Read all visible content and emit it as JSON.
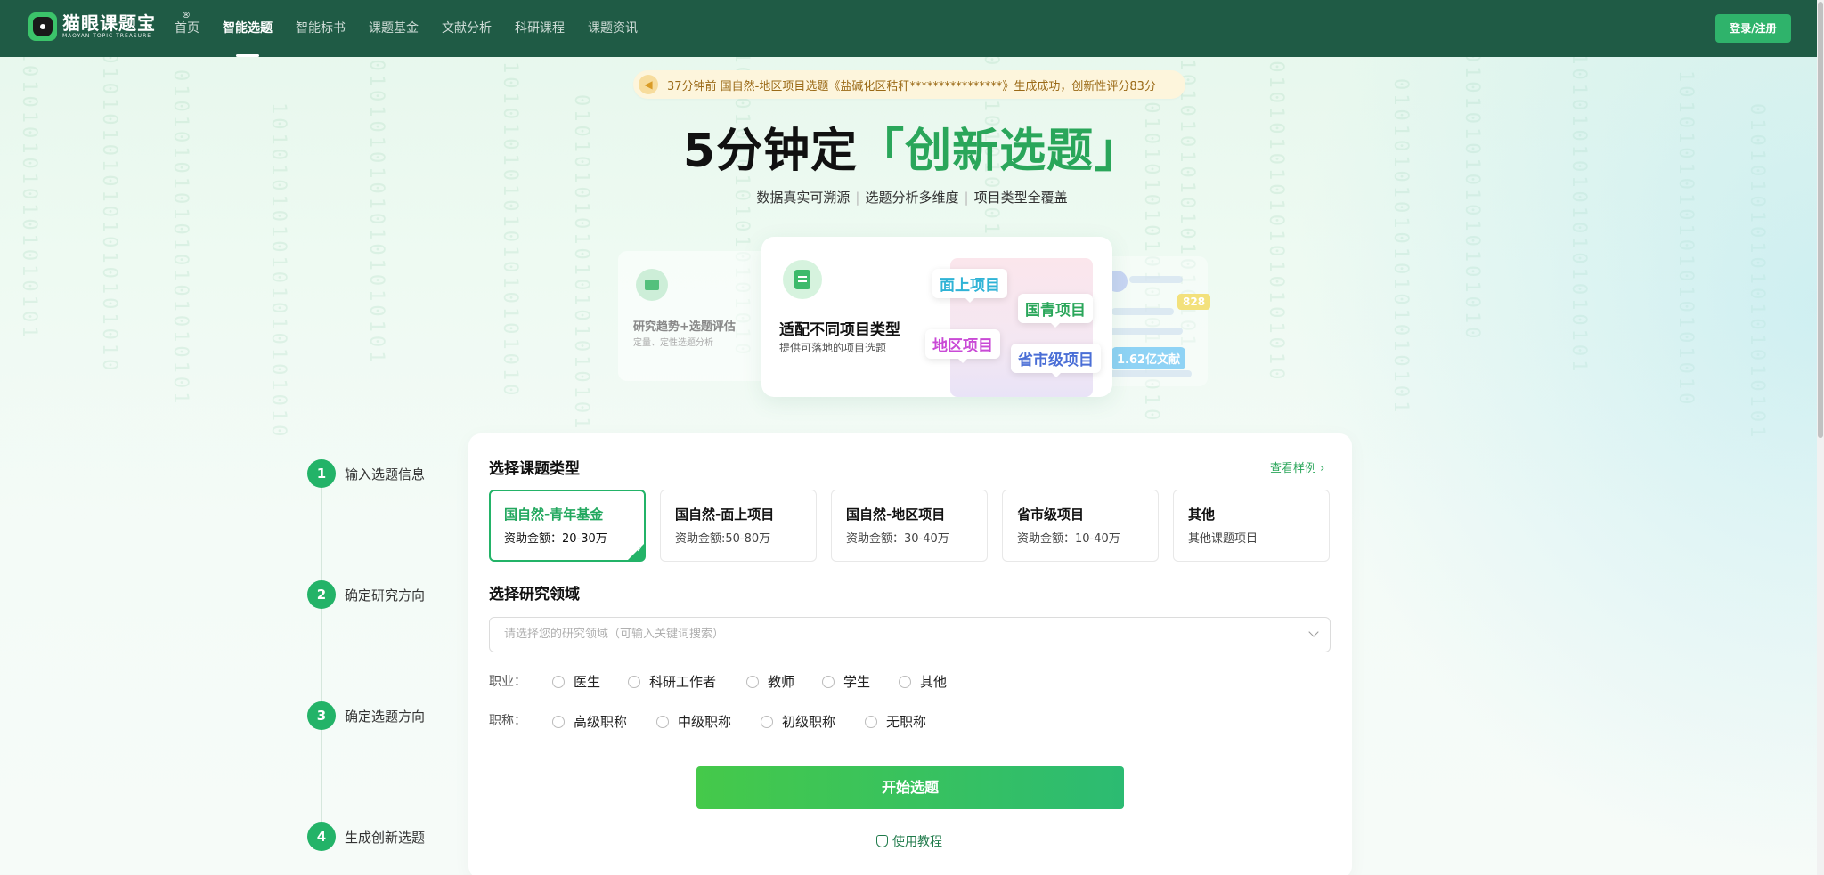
{
  "header": {
    "logo_cn": "猫眼课题宝",
    "logo_en": "MAOYAN TOPIC TREASURE",
    "logo_reg": "®",
    "nav": [
      {
        "label": "首页"
      },
      {
        "label": "智能选题",
        "active": true
      },
      {
        "label": "智能标书"
      },
      {
        "label": "课题基金"
      },
      {
        "label": "文献分析"
      },
      {
        "label": "科研课程"
      },
      {
        "label": "课题资讯"
      }
    ],
    "login_label": "登录/注册"
  },
  "notice": {
    "text": "37分钟前  国自然-地区项目选题《盐碱化区秸秆****************》生成成功，创新性评分83分",
    "icon": "speaker-icon"
  },
  "hero": {
    "title_prefix": "5分钟定",
    "title_accent": "「创新选题」",
    "sub": [
      "数据真实可溯源",
      "选题分析多维度",
      "项目类型全覆盖"
    ]
  },
  "carousel": {
    "left": {
      "title": "研究趋势+选题评估",
      "sub": "定量、定性选题分析"
    },
    "main": {
      "title": "适配不同项目类型",
      "sub": "提供可落地的项目选题",
      "tags": [
        {
          "label": "面上项目",
          "color": "#2fb3d6"
        },
        {
          "label": "国青项目",
          "color": "#2aa65a"
        },
        {
          "label": "地区项目",
          "color": "#c94ad6"
        },
        {
          "label": "省市级项目",
          "color": "#4a6ed6"
        }
      ]
    },
    "right": {
      "badge_number": "828",
      "badge_docs": "1.62亿文献"
    }
  },
  "steps": [
    {
      "num": "1",
      "label": "输入选题信息"
    },
    {
      "num": "2",
      "label": "确定研究方向"
    },
    {
      "num": "3",
      "label": "确定选题方向"
    },
    {
      "num": "4",
      "label": "生成创新选题"
    }
  ],
  "form": {
    "type_title": "选择课题类型",
    "see_example": "查看样例 ›",
    "types": [
      {
        "name": "国自然-青年基金",
        "amount": "资助金额：20-30万",
        "selected": true
      },
      {
        "name": "国自然-面上项目",
        "amount": "资助金额:50-80万"
      },
      {
        "name": "国自然-地区项目",
        "amount": "资助金额：30-40万"
      },
      {
        "name": "省市级项目",
        "amount": "资助金额：10-40万"
      },
      {
        "name": "其他",
        "amount": "其他课题项目"
      }
    ],
    "field_title": "选择研究领域",
    "field_placeholder": "请选择您的研究领域（可输入关键词搜索）",
    "occupation_label": "职业：",
    "occupations": [
      "医生",
      "科研工作者",
      "教师",
      "学生",
      "其他"
    ],
    "rank_label": "职称：",
    "ranks": [
      "高级职称",
      "中级职称",
      "初级职称",
      "无职称"
    ],
    "start_label": "开始选题",
    "tutorial_label": "使用教程"
  },
  "colors": {
    "header_bg": "#1f5b45",
    "accent": "#23b368"
  }
}
